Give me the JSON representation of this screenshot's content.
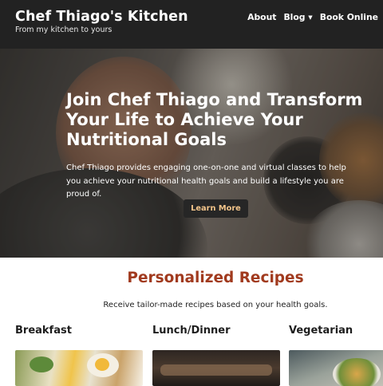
{
  "header": {
    "title": "Chef Thiago's Kitchen",
    "tagline": "From my kitchen to yours",
    "nav": [
      {
        "label": "About"
      },
      {
        "label": "Blog ▾"
      },
      {
        "label": "Book Online"
      }
    ]
  },
  "hero": {
    "title": "Join Chef Thiago and Transform Your Life to Achieve Your Nutritional Goals",
    "text": "Chef Thiago provides engaging one-on-one and virtual classes to help you achieve your nutritional health goals and build a lifestyle you are proud of.",
    "button": "Learn More"
  },
  "recipes": {
    "title": "Personalized Recipes",
    "subtitle": "Receive tailor-made recipes based on your health goals.",
    "categories": [
      {
        "label": "Breakfast"
      },
      {
        "label": "Lunch/Dinner"
      },
      {
        "label": "Vegetarian"
      }
    ]
  },
  "colors": {
    "header_bg": "#222222",
    "accent": "#a13a1e",
    "button_bg": "#262626",
    "button_text": "#f2c48a"
  }
}
